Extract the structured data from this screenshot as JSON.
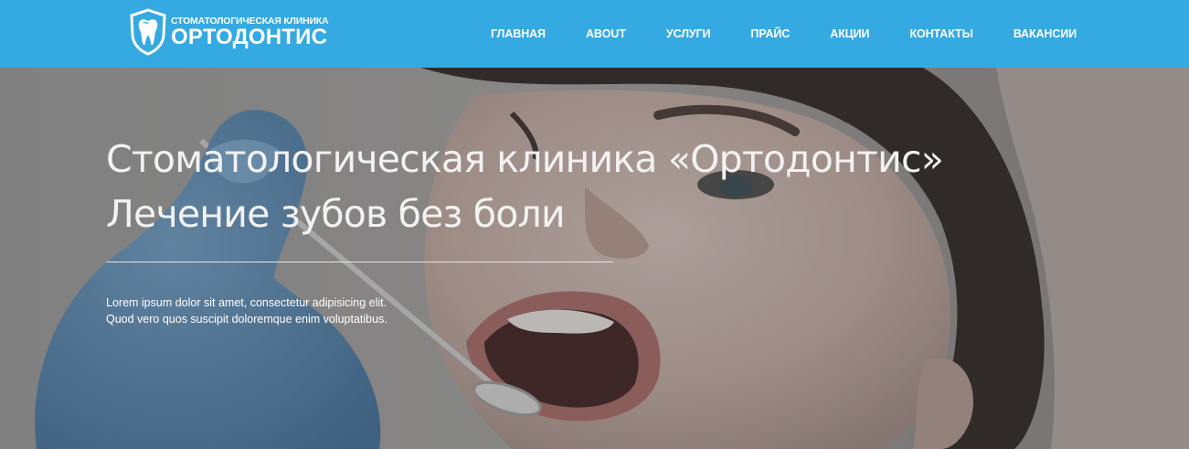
{
  "header": {
    "background_color": "#35a9e1",
    "logo": {
      "subtitle": "СТОМАТОЛОГИЧЕСКАЯ КЛИНИКА",
      "name": "ОРТОДОНТИС",
      "icon": "tooth-shield-icon"
    },
    "nav": [
      {
        "label": "ГЛАВНАЯ"
      },
      {
        "label": "ABOUT"
      },
      {
        "label": "УСЛУГИ"
      },
      {
        "label": "ПРАЙС"
      },
      {
        "label": "АКЦИИ"
      },
      {
        "label": "КОНТАКТЫ"
      },
      {
        "label": "ВАКАНСИИ"
      }
    ]
  },
  "hero": {
    "title_line1": "Стоматологическая клиника «Ортодонтис»",
    "title_line2": "Лечение зубов без боли",
    "text_line1": "Lorem ipsum dolor sit amet, consectetur adipisicing elit.",
    "text_line2": "Quod vero quos suscipit doloremque enim voluptatibus.",
    "image": "dental-patient-photo"
  }
}
